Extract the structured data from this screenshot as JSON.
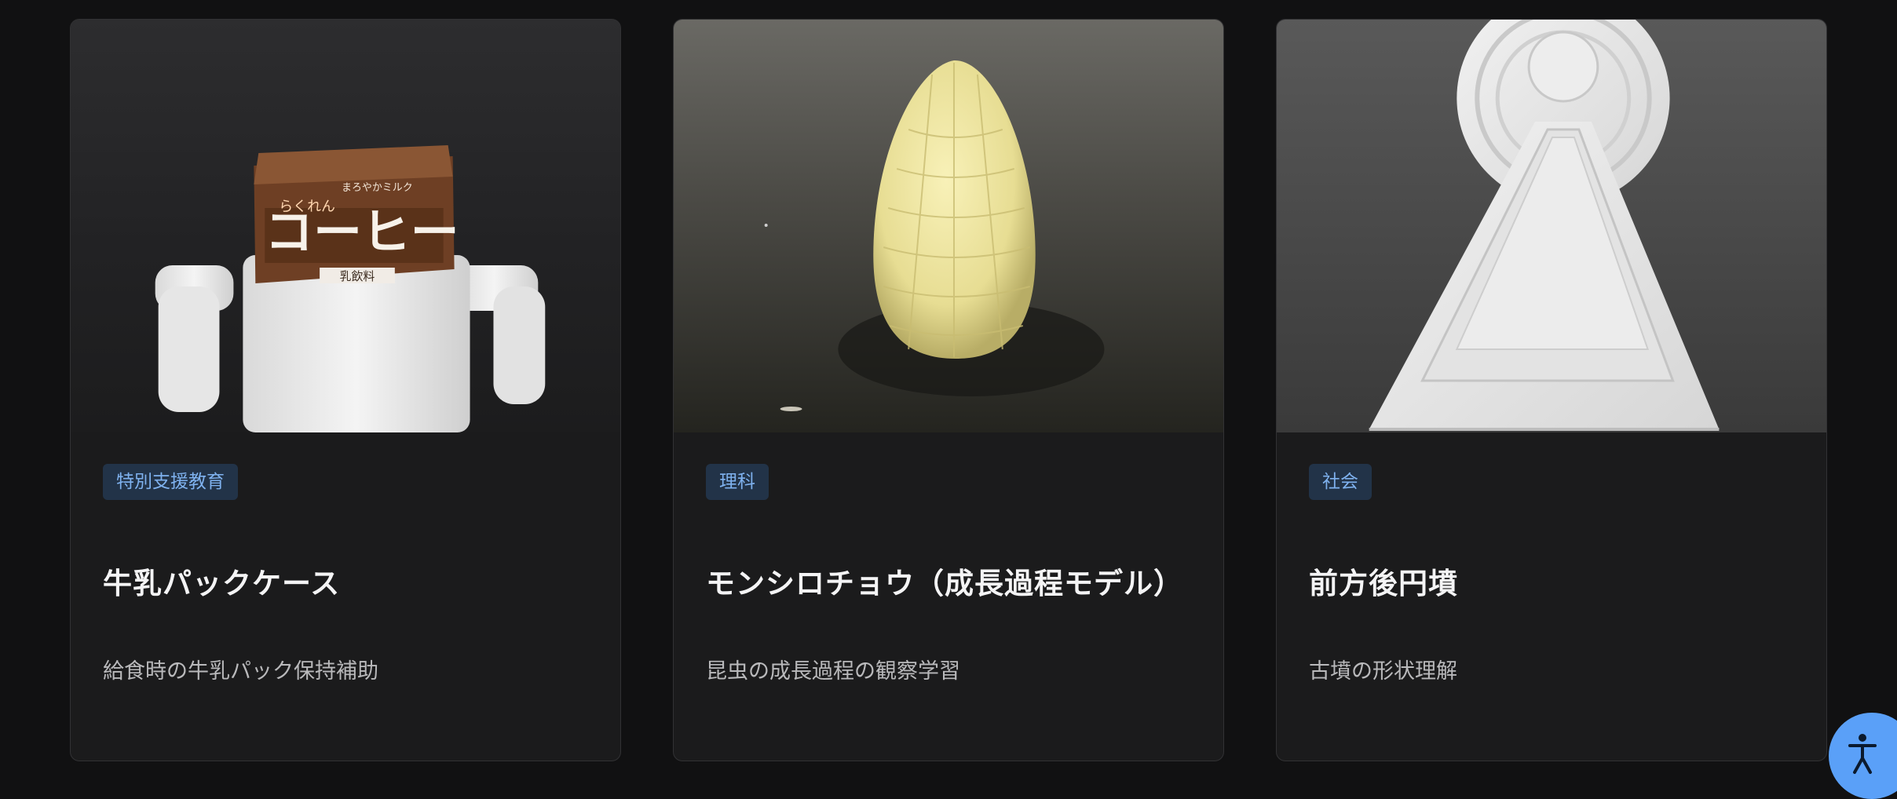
{
  "cards": [
    {
      "tag": "特別支援教育",
      "title": "牛乳パックケース",
      "description": "給食時の牛乳パック保持補助",
      "image_label_brand": "らくれん",
      "image_label_sub": "まろやかミルク",
      "image_label_main": "コーヒー",
      "image_label_type": "乳飲料"
    },
    {
      "tag": "理科",
      "title": "モンシロチョウ（成長過程モデル）",
      "description": "昆虫の成長過程の観察学習"
    },
    {
      "tag": "社会",
      "title": "前方後円墳",
      "description": "古墳の形状理解"
    }
  ],
  "accessibility_button": {
    "icon": "accessibility-person-icon"
  },
  "colors": {
    "page_bg": "#111112",
    "card_bg": "#1b1b1c",
    "tag_bg": "#223348",
    "tag_text": "#7fb2ef",
    "accent": "#5aa0f8"
  }
}
